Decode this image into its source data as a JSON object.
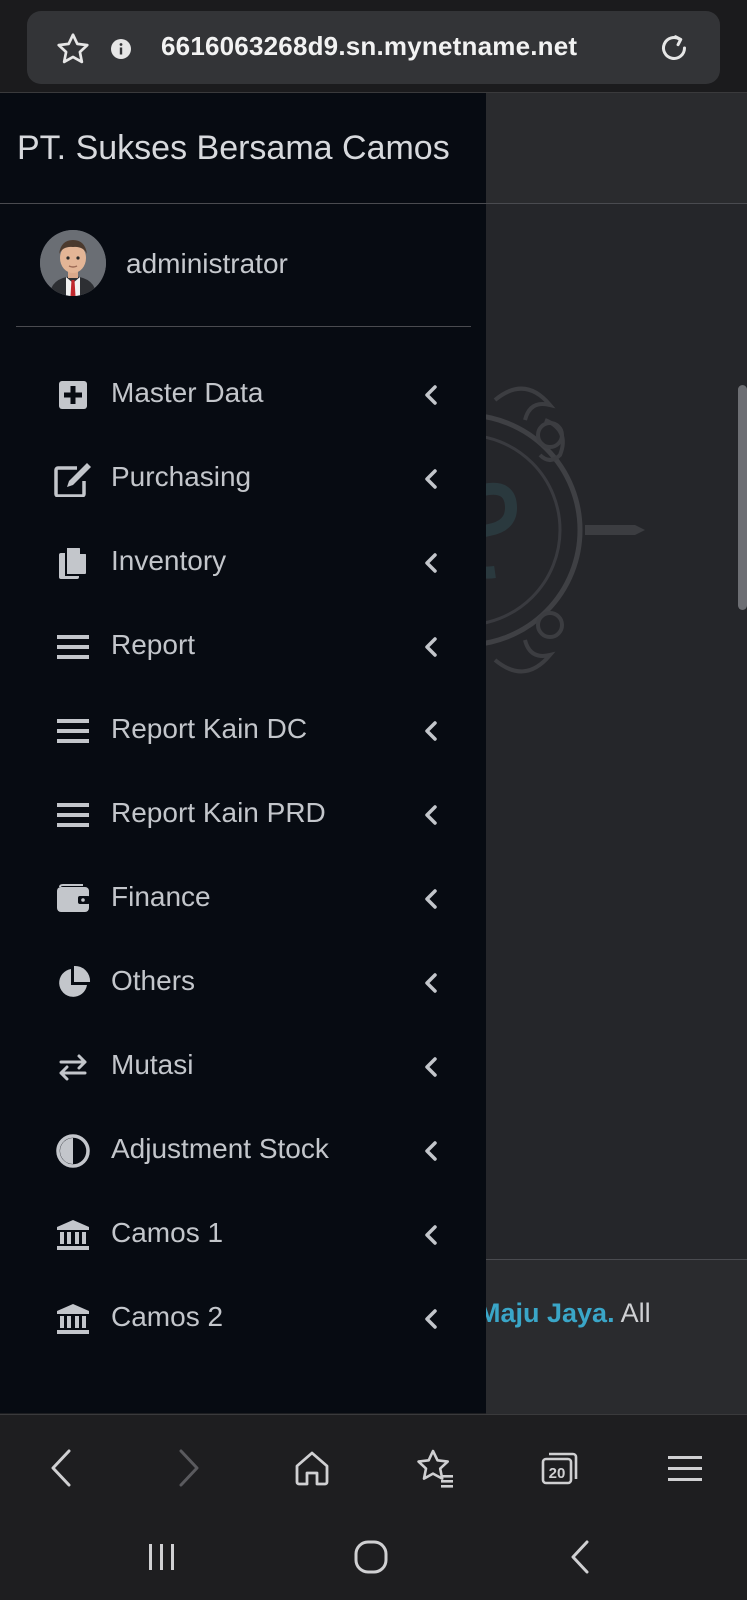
{
  "browser": {
    "url": "6616063268d9.sn.mynetname.net",
    "tab_count": "20"
  },
  "sidebar": {
    "brand": "PT. Sukses Bersama Camos",
    "user": "administrator",
    "items": [
      {
        "label": "Master Data",
        "icon": "plus-square-icon"
      },
      {
        "label": "Purchasing",
        "icon": "edit-icon"
      },
      {
        "label": "Inventory",
        "icon": "copy-icon"
      },
      {
        "label": "Report",
        "icon": "bars-icon"
      },
      {
        "label": "Report Kain DC",
        "icon": "bars-icon"
      },
      {
        "label": "Report Kain PRD",
        "icon": "bars-icon"
      },
      {
        "label": "Finance",
        "icon": "wallet-icon"
      },
      {
        "label": "Others",
        "icon": "pie-chart-icon"
      },
      {
        "label": "Mutasi",
        "icon": "exchange-icon"
      },
      {
        "label": "Adjustment Stock",
        "icon": "adjust-icon"
      },
      {
        "label": "Camos 1",
        "icon": "bank-icon"
      },
      {
        "label": "Camos 2",
        "icon": "bank-icon"
      }
    ]
  },
  "footer": {
    "brand_fragment": "Maju Jaya.",
    "text_fragment": "All"
  },
  "colors": {
    "sidebar_bg": "#070b12",
    "page_bg": "#26272b",
    "accent": "#3aa6c8",
    "text": "#c3c6cb"
  }
}
